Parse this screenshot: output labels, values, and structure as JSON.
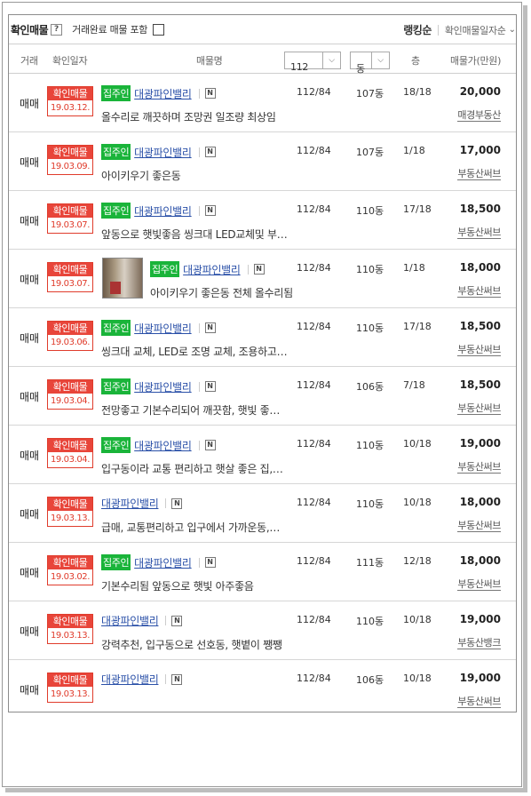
{
  "topbar": {
    "title": "확인매물",
    "help_icon": "question-icon",
    "include_label": "거래완료 매물 포함",
    "sort_rank": "랭킹순",
    "sort_date": "확인매물일자순"
  },
  "header": {
    "deal": "거래",
    "date": "확인일자",
    "name": "매물명",
    "area_select": "112",
    "dong_select": "동",
    "floor": "층",
    "price": "매물가(만원)"
  },
  "listings": [
    {
      "deal": "매매",
      "stamp": "확인매물",
      "date": "19.03.12.",
      "badge": "집주인",
      "name": "대광파인밸리",
      "desc": "올수리로 깨끗하며 조망권 일조량 최상임",
      "area": "112/84",
      "dong": "107동",
      "floor": "18/18",
      "price": "20,000",
      "agency": "매경부동산",
      "thumb": false
    },
    {
      "deal": "매매",
      "stamp": "확인매물",
      "date": "19.03.09.",
      "badge": "집주인",
      "name": "대광파인밸리",
      "desc": "아이키우기 좋은동",
      "area": "112/84",
      "dong": "107동",
      "floor": "1/18",
      "price": "17,000",
      "agency": "부동산써브",
      "thumb": false
    },
    {
      "deal": "매매",
      "stamp": "확인매물",
      "date": "19.03.07.",
      "badge": "집주인",
      "name": "대광파인밸리",
      "desc": "앞동으로 햇빛좋음 씽크대 LED교체및 부…",
      "area": "112/84",
      "dong": "110동",
      "floor": "17/18",
      "price": "18,500",
      "agency": "부동산써브",
      "thumb": false
    },
    {
      "deal": "매매",
      "stamp": "확인매물",
      "date": "19.03.07.",
      "badge": "집주인",
      "name": "대광파인밸리",
      "desc": "아이키우기 좋은동 전체 올수리됨",
      "area": "112/84",
      "dong": "110동",
      "floor": "1/18",
      "price": "18,000",
      "agency": "부동산써브",
      "thumb": true
    },
    {
      "deal": "매매",
      "stamp": "확인매물",
      "date": "19.03.06.",
      "badge": "집주인",
      "name": "대광파인밸리",
      "desc": "씽크대 교체, LED로 조명 교체, 조용하고…",
      "area": "112/84",
      "dong": "110동",
      "floor": "17/18",
      "price": "18,500",
      "agency": "부동산써브",
      "thumb": false
    },
    {
      "deal": "매매",
      "stamp": "확인매물",
      "date": "19.03.04.",
      "badge": "집주인",
      "name": "대광파인밸리",
      "desc": "전망좋고 기본수리되어 깨끗함, 햇빛 좋…",
      "area": "112/84",
      "dong": "106동",
      "floor": "7/18",
      "price": "18,500",
      "agency": "부동산써브",
      "thumb": false
    },
    {
      "deal": "매매",
      "stamp": "확인매물",
      "date": "19.03.04.",
      "badge": "집주인",
      "name": "대광파인밸리",
      "desc": "입구동이라 교통 편리하고 햇살 좋은 집,…",
      "area": "112/84",
      "dong": "110동",
      "floor": "10/18",
      "price": "19,000",
      "agency": "부동산써브",
      "thumb": false
    },
    {
      "deal": "매매",
      "stamp": "확인매물",
      "date": "19.03.13.",
      "badge": "",
      "name": "대광파인밸리",
      "desc": "급매, 교통편리하고 입구에서 가까운동,…",
      "area": "112/84",
      "dong": "110동",
      "floor": "10/18",
      "price": "18,000",
      "agency": "부동산써브",
      "thumb": false
    },
    {
      "deal": "매매",
      "stamp": "확인매물",
      "date": "19.03.02.",
      "badge": "집주인",
      "name": "대광파인밸리",
      "desc": "기본수리됨 앞동으로 햇빛 아주좋음",
      "area": "112/84",
      "dong": "111동",
      "floor": "12/18",
      "price": "18,000",
      "agency": "부동산써브",
      "thumb": false
    },
    {
      "deal": "매매",
      "stamp": "확인매물",
      "date": "19.03.13.",
      "badge": "",
      "name": "대광파인밸리",
      "desc": "강력추천, 입구동으로 선호동, 햇볕이 쨍쨍",
      "area": "112/84",
      "dong": "110동",
      "floor": "10/18",
      "price": "19,000",
      "agency": "부동산뱅크",
      "thumb": false
    },
    {
      "deal": "매매",
      "stamp": "확인매물",
      "date": "19.03.13.",
      "badge": "",
      "name": "대광파인밸리",
      "desc": "",
      "area": "112/84",
      "dong": "106동",
      "floor": "10/18",
      "price": "19,000",
      "agency": "부동산써브",
      "thumb": false
    }
  ]
}
